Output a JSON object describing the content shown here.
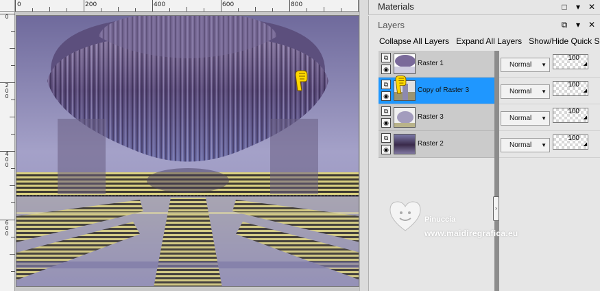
{
  "rulers": {
    "top_labels": [
      "0",
      "200",
      "400",
      "600",
      "800"
    ],
    "left_labels": [
      "0",
      "200",
      "400",
      "600"
    ]
  },
  "materials_panel": {
    "title": "Materials"
  },
  "layers_panel": {
    "title": "Layers",
    "toolbar": {
      "collapse_all": "Collapse All Layers",
      "expand_all": "Expand All Layers",
      "show_hide": "Show/Hide Quick Search"
    },
    "layers": [
      {
        "name": "Raster 1",
        "blend_mode": "Normal",
        "opacity": "100",
        "selected": false
      },
      {
        "name": "Copy of Raster 3",
        "blend_mode": "Normal",
        "opacity": "100",
        "selected": true
      },
      {
        "name": "Raster 3",
        "blend_mode": "Normal",
        "opacity": "100",
        "selected": false
      },
      {
        "name": "Raster 2",
        "blend_mode": "Normal",
        "opacity": "100",
        "selected": false
      }
    ]
  },
  "watermark": {
    "name": "Pinuccia",
    "url": "www.maidiregrafica.eu"
  },
  "colors": {
    "selected_row": "#1f97ff",
    "canvas_purple": "#8a86b6",
    "canvas_gold": "#c8bf6a"
  }
}
